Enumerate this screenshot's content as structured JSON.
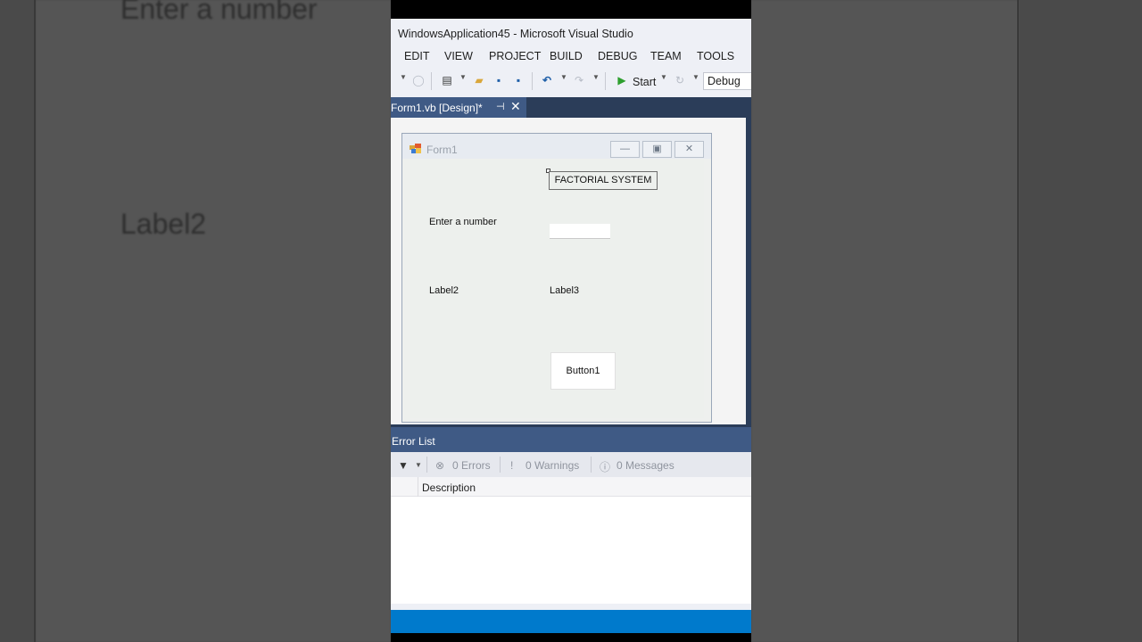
{
  "background": {
    "left_text_top": "Enter a number",
    "left_text_mid": "Label2"
  },
  "window": {
    "title": "WindowsApplication45 - Microsoft Visual Studio"
  },
  "menu": [
    "EDIT",
    "VIEW",
    "PROJECT",
    "BUILD",
    "DEBUG",
    "TEAM",
    "TOOLS"
  ],
  "toolbar": {
    "start_label": "Start",
    "config_value": "Debug"
  },
  "document_tab": {
    "label": "Form1.vb [Design]*"
  },
  "form": {
    "caption": "Form1",
    "heading_label": "FACTORIAL SYSTEM",
    "enter_label": "Enter a number",
    "textbox_value": "",
    "label2": "Label2",
    "label3": "Label3",
    "button1": "Button1"
  },
  "error_list": {
    "title": "Error List",
    "errors": "0 Errors",
    "warnings": "0 Warnings",
    "messages": "0 Messages",
    "column_description": "Description"
  },
  "colors": {
    "accent": "#007acc",
    "tab_active": "#3f5a85",
    "tab_strip": "#2b3d59",
    "start_green": "#2e9f2e"
  }
}
